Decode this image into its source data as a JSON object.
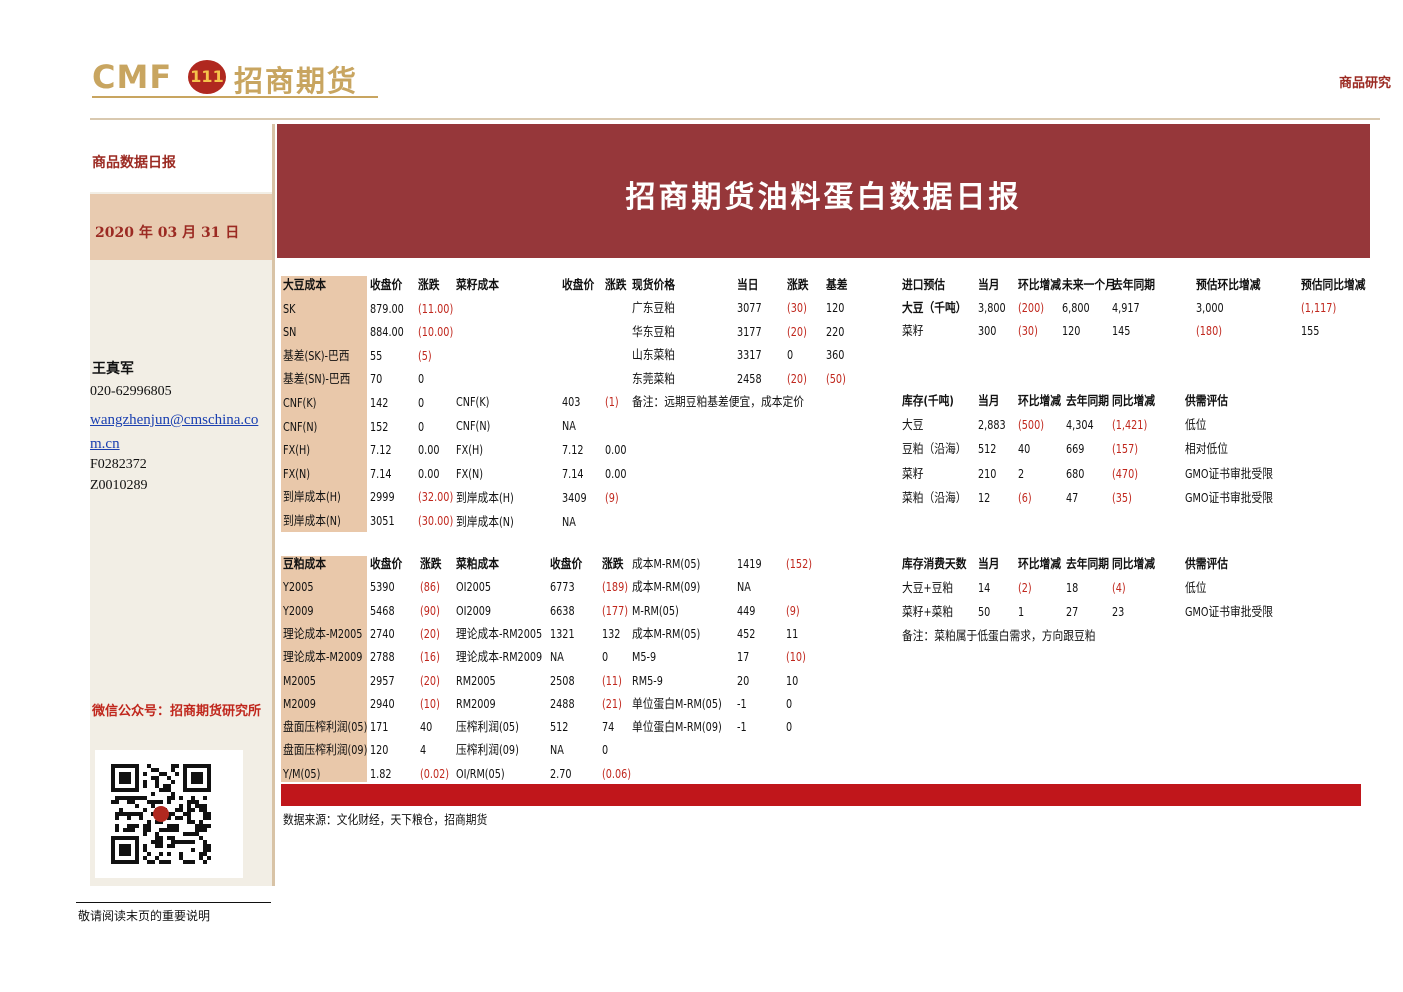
{
  "header": {
    "logo_en": "CMF",
    "logo_badge": "111",
    "logo_cn": "招商期货",
    "top_right": "商品研究"
  },
  "sidebar": {
    "title": "商品数据日报",
    "date": "2020 年 03 月 31 日",
    "analyst": "王真军",
    "phone": "020-62996805",
    "email": "wangzhenjun@cmschina.com.cn",
    "id1": "F0282372",
    "id2": "Z0010289",
    "wechat": "微信公众号：招商期货研究所"
  },
  "banner": {
    "title": "招商期货油料蛋白数据日报"
  },
  "soy_cost": {
    "headers": [
      "大豆成本",
      "收盘价",
      "涨跌"
    ],
    "rows": [
      [
        "SK",
        "879.00",
        "(11.00)"
      ],
      [
        "SN",
        "884.00",
        "(10.00)"
      ],
      [
        "基差(SK)-巴西",
        "55",
        "(5)"
      ],
      [
        "基差(SN)-巴西",
        "70",
        "0"
      ],
      [
        "CNF(K)",
        "142",
        "0"
      ],
      [
        "CNF(N)",
        "152",
        "0"
      ],
      [
        "FX(H)",
        "7.12",
        "0.00"
      ],
      [
        "FX(N)",
        "7.14",
        "0.00"
      ],
      [
        "到岸成本(H)",
        "2999",
        "(32.00)"
      ],
      [
        "到岸成本(N)",
        "3051",
        "(30.00)"
      ]
    ]
  },
  "rapeseed_cost": {
    "headers": [
      "菜籽成本",
      "收盘价",
      "涨跌"
    ],
    "rows": [
      [
        "CNF(K)",
        "403",
        "(1)"
      ],
      [
        "CNF(N)",
        "NA",
        ""
      ],
      [
        "FX(H)",
        "7.12",
        "0.00"
      ],
      [
        "FX(N)",
        "7.14",
        "0.00"
      ],
      [
        "到岸成本(H)",
        "3409",
        "(9)"
      ],
      [
        "到岸成本(N)",
        "NA",
        ""
      ]
    ]
  },
  "spot": {
    "headers": [
      "现货价格",
      "当日",
      "涨跌",
      "基差"
    ],
    "rows": [
      [
        "广东豆粕",
        "3077",
        "(30)",
        "120"
      ],
      [
        "华东豆粕",
        "3177",
        "(20)",
        "220"
      ],
      [
        "山东菜粕",
        "3317",
        "0",
        "360"
      ],
      [
        "东莞菜粕",
        "2458",
        "(20)",
        "(50)"
      ]
    ],
    "note": "备注：远期豆粕基差便宜，成本定价"
  },
  "import_forecast": {
    "headers": [
      "进口预估",
      "当月",
      "环比增减",
      "未来一个月",
      "去年同期",
      "预估环比增减",
      "预估同比增减"
    ],
    "rows": [
      [
        "大豆（千吨）",
        "3,800",
        "(200)",
        "6,800",
        "4,917",
        "3,000",
        "(1,117)"
      ],
      [
        "菜籽",
        "300",
        "(30)",
        "120",
        "145",
        "(180)",
        "155"
      ]
    ]
  },
  "inventory": {
    "headers": [
      "库存(千吨)",
      "当月",
      "环比增减",
      "去年同期",
      "同比增减",
      "供需评估"
    ],
    "rows": [
      [
        "大豆",
        "2,883",
        "(500)",
        "4,304",
        "(1,421)",
        "低位"
      ],
      [
        "豆粕（沿海）",
        "512",
        "40",
        "669",
        "(157)",
        "相对低位"
      ],
      [
        "菜籽",
        "210",
        "2",
        "680",
        "(470)",
        "GMO证书审批受限"
      ],
      [
        "菜粕（沿海）",
        "12",
        "(6)",
        "47",
        "(35)",
        "GMO证书审批受限"
      ]
    ]
  },
  "meal_cost": {
    "headers": [
      "豆粕成本",
      "收盘价",
      "涨跌"
    ],
    "rows": [
      [
        "Y2005",
        "5390",
        "(86)"
      ],
      [
        "Y2009",
        "5468",
        "(90)"
      ],
      [
        "理论成本-M2005",
        "2740",
        "(20)"
      ],
      [
        "理论成本-M2009",
        "2788",
        "(16)"
      ],
      [
        "M2005",
        "2957",
        "(20)"
      ],
      [
        "M2009",
        "2940",
        "(10)"
      ],
      [
        "盘面压榨利润(05)",
        "171",
        "40"
      ],
      [
        "盘面压榨利润(09)",
        "120",
        "4"
      ],
      [
        "Y/M(05)",
        "1.82",
        "(0.02)"
      ]
    ]
  },
  "rapemeal_cost": {
    "headers": [
      "菜粕成本",
      "收盘价",
      "涨跌"
    ],
    "rows": [
      [
        "OI2005",
        "6773",
        "(189)"
      ],
      [
        "OI2009",
        "6638",
        "(177)"
      ],
      [
        "理论成本-RM2005",
        "1321",
        "132"
      ],
      [
        "理论成本-RM2009",
        "NA",
        "0"
      ],
      [
        "RM2005",
        "2508",
        "(11)"
      ],
      [
        "RM2009",
        "2488",
        "(21)"
      ],
      [
        "压榨利润(05)",
        "512",
        "74"
      ],
      [
        "压榨利润(09)",
        "NA",
        "0"
      ],
      [
        "OI/RM(05)",
        "2.70",
        "(0.06)"
      ]
    ]
  },
  "spreads": {
    "rows": [
      [
        "成本M-RM(05)",
        "1419",
        "(152)"
      ],
      [
        "成本M-RM(09)",
        "NA",
        ""
      ],
      [
        "M-RM(05)",
        "449",
        "(9)"
      ],
      [
        "成本M-RM(05)",
        "452",
        "11"
      ],
      [
        "M5-9",
        "17",
        "(10)"
      ],
      [
        "RM5-9",
        "20",
        "10"
      ],
      [
        "单位蛋白M-RM(05)",
        "-1",
        "0"
      ],
      [
        "单位蛋白M-RM(09)",
        "-1",
        "0"
      ]
    ]
  },
  "inventory_days": {
    "headers": [
      "库存消费天数",
      "当月",
      "环比增减",
      "去年同期",
      "同比增减",
      "供需评估"
    ],
    "rows": [
      [
        "大豆+豆粕",
        "14",
        "(2)",
        "18",
        "(4)",
        "低位"
      ],
      [
        "菜籽+菜粕",
        "50",
        "1",
        "27",
        "23",
        "GMO证书审批受限"
      ]
    ],
    "note": "备注：菜粕属于低蛋白需求，方向跟豆粕"
  },
  "source": "数据来源：文化财经，天下粮仓，招商期货",
  "footer": "敬请阅读末页的重要说明"
}
